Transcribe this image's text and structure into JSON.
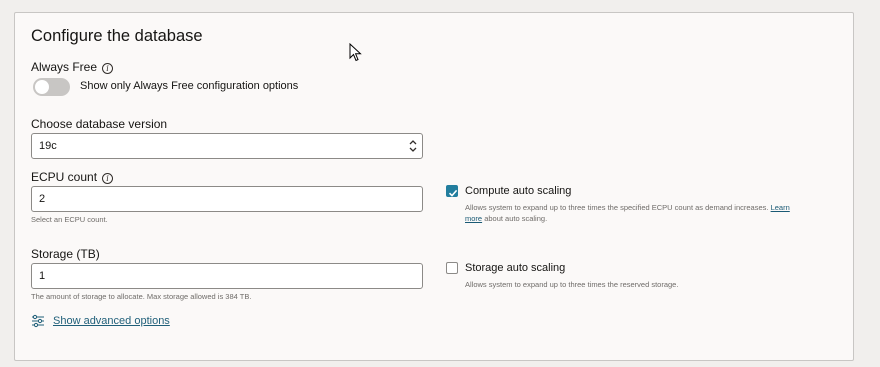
{
  "panel": {
    "title": "Configure the database"
  },
  "always_free": {
    "label": "Always Free",
    "toggle_label": "Show only Always Free configuration options",
    "enabled": false
  },
  "db_version": {
    "label": "Choose database version",
    "value": "19c"
  },
  "ecpu": {
    "label": "ECPU count",
    "value": "2",
    "help": "Select an ECPU count."
  },
  "compute_autoscaling": {
    "label": "Compute auto scaling",
    "checked": true,
    "help_prefix": "Allows system to expand up to three times the specified ECPU count as demand increases.",
    "help_link_1": "Learn",
    "help_link_2": "more",
    "help_suffix": "about auto scaling."
  },
  "storage": {
    "label": "Storage (TB)",
    "value": "1",
    "help": "The amount of storage to allocate. Max storage allowed is 384 TB."
  },
  "storage_autoscaling": {
    "label": "Storage auto scaling",
    "checked": false,
    "help": "Allows system to expand up to three times the reserved storage."
  },
  "advanced": {
    "link_label": "Show advanced options"
  },
  "colors": {
    "accent": "#227e9e",
    "link": "#1f5f79"
  }
}
